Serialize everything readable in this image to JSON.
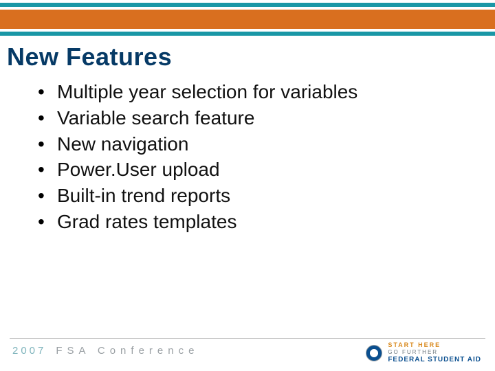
{
  "title": "New Features",
  "bullets": [
    "Multiple year selection for variables",
    "Variable search feature",
    "New navigation",
    "Power.User upload",
    "Built-in trend reports",
    "Grad rates templates"
  ],
  "footer": {
    "year": "2007",
    "conference": "FSA Conference"
  },
  "logo": {
    "line1": "START HERE",
    "line2": "GO FURTHER",
    "line3": "FEDERAL STUDENT AID"
  },
  "colors": {
    "orange": "#d96f1f",
    "teal": "#1a97a6",
    "title": "#063a66"
  }
}
